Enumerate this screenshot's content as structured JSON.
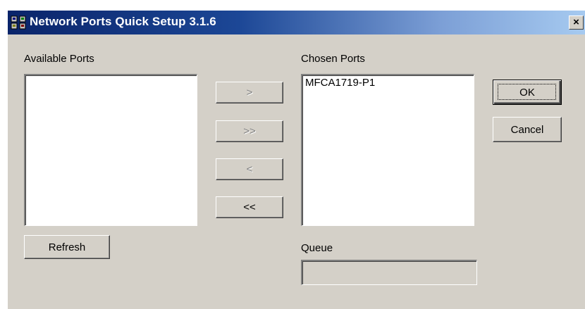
{
  "window": {
    "title": "Network Ports Quick Setup 3.1.6",
    "close_label": "×"
  },
  "available": {
    "label": "Available Ports",
    "items": []
  },
  "chosen": {
    "label": "Chosen Ports",
    "items": [
      "MFCA1719-P1"
    ]
  },
  "transfer": {
    "add_label": ">",
    "add_all_label": ">>",
    "remove_label": "<",
    "remove_all_label": "<<"
  },
  "actions": {
    "ok_label": "OK",
    "cancel_label": "Cancel",
    "refresh_label": "Refresh"
  },
  "queue": {
    "label": "Queue",
    "value": ""
  }
}
